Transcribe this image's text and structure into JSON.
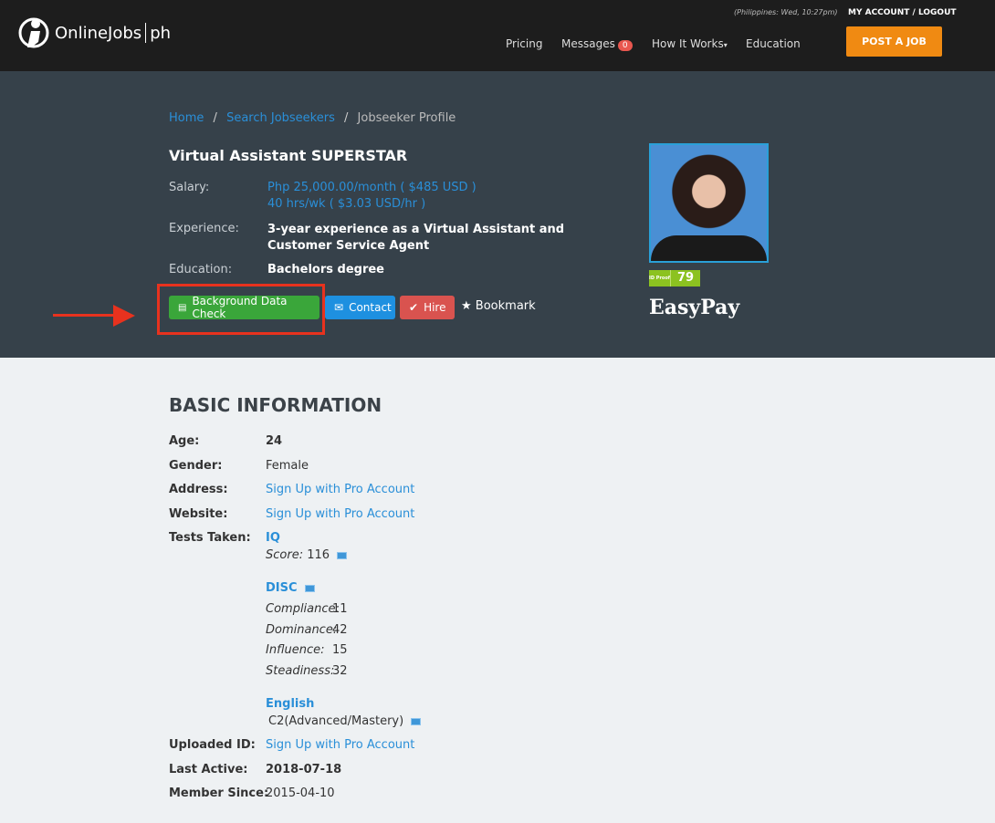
{
  "header": {
    "brand": "OnlineJobs",
    "brand_suffix": "ph",
    "timezone": "(Philippines: Wed, 10:27pm)",
    "account": "MY ACCOUNT / LOGOUT",
    "nav": [
      {
        "label": "Pricing"
      },
      {
        "label": "Messages",
        "badge": "0"
      },
      {
        "label": "How It Works"
      },
      {
        "label": "Education"
      }
    ],
    "post_job": "POST A JOB"
  },
  "breadcrumb": {
    "home": "Home",
    "search": "Search Jobseekers",
    "current": "Jobseeker Profile",
    "sep": "/"
  },
  "profile": {
    "title": "Virtual Assistant SUPERSTAR",
    "salary_label": "Salary:",
    "salary_month": "Php 25,000.00/month ( $485 USD )",
    "salary_hours": "40 hrs/wk ( $3.03 USD/hr )",
    "experience_label": "Experience:",
    "experience": "3-year experience as a Virtual Assistant and Customer Service Agent",
    "education_label": "Education:",
    "education": "Bachelors degree",
    "id_proof_label": "ID Proof",
    "id_proof_score": "79",
    "easypay": "EasyPay"
  },
  "actions": {
    "background": "Background Data Check",
    "contact": "Contact",
    "hire": "Hire",
    "bookmark": "Bookmark"
  },
  "colors": {
    "accent": "#2a8fd8",
    "green": "#3aa63a",
    "blue": "#1e90e0",
    "red": "#d9534f",
    "orange": "#f08a12",
    "highlight": "#e8321e"
  },
  "basic": {
    "heading": "BASIC INFORMATION",
    "age_label": "Age:",
    "age": "24",
    "gender_label": "Gender:",
    "gender": "Female",
    "address_label": "Address:",
    "address": "Sign Up with Pro Account",
    "website_label": "Website:",
    "website": "Sign Up with Pro Account",
    "tests_label": "Tests Taken:",
    "iq": {
      "name": "IQ",
      "score_label": "Score:",
      "score": "116"
    },
    "disc": {
      "name": "DISC",
      "rows": [
        {
          "k": "Compliance:",
          "v": "11"
        },
        {
          "k": "Dominance:",
          "v": "42"
        },
        {
          "k": "Influence:",
          "v": "15"
        },
        {
          "k": "Steadiness:",
          "v": "32"
        }
      ]
    },
    "english": {
      "name": "English",
      "level": "C2(Advanced/Mastery)"
    },
    "uploaded_label": "Uploaded ID:",
    "uploaded": "Sign Up with Pro Account",
    "last_active_label": "Last Active:",
    "last_active": "2018-07-18",
    "member_label": "Member Since:",
    "member": "2015-04-10"
  }
}
